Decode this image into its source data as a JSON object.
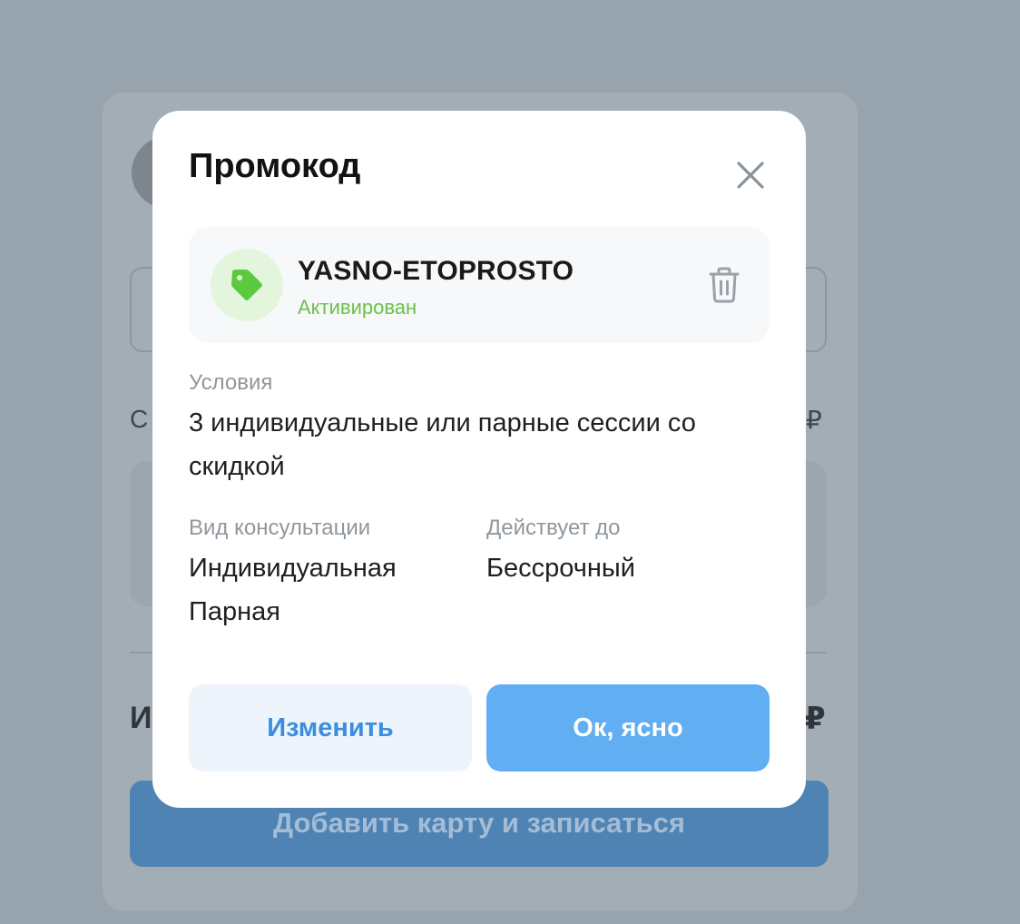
{
  "background": {
    "sum_label": "С",
    "sum_value": "₽",
    "total_label": "И",
    "total_value": "₽",
    "submit_label": "Добавить карту и записаться"
  },
  "modal": {
    "title": "Промокод",
    "close_icon": "close-icon",
    "promo": {
      "code": "YASNO-ETOPROSTO",
      "status": "Активирован",
      "icon": "tag-icon",
      "delete_icon": "trash-icon"
    },
    "conditions": {
      "label": "Условия",
      "value": "3 индивидуальные или парные сессии со скидкой"
    },
    "consultation_type": {
      "label": "Вид консультации",
      "values": [
        "Индивидуальная",
        "Парная"
      ]
    },
    "valid_until": {
      "label": "Действует до",
      "value": "Бессрочный"
    },
    "buttons": {
      "change": "Изменить",
      "ok": "Ок, ясно"
    }
  },
  "colors": {
    "overlay": "#97a3ad",
    "accent": "#61aef3",
    "accent_text": "#3b8de0",
    "success": "#6cc04a"
  }
}
